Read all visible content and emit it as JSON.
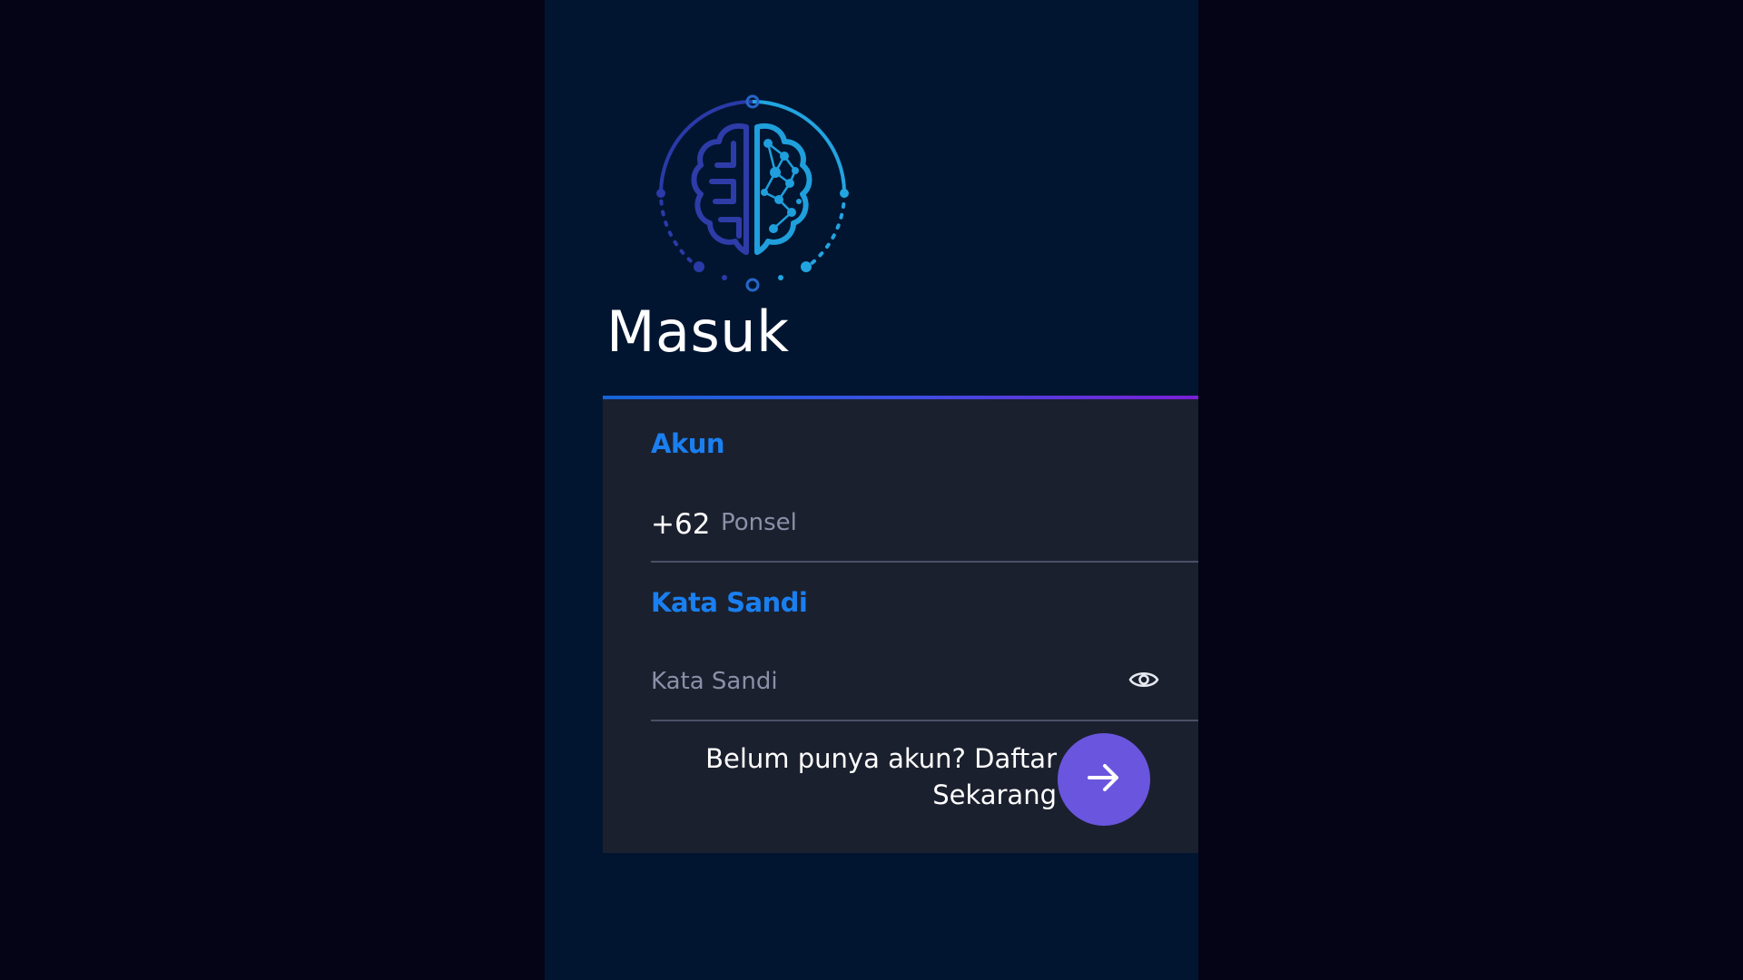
{
  "page": {
    "title": "Masuk"
  },
  "form": {
    "account_label": "Akun",
    "country_code": "+62",
    "phone_placeholder": "Ponsel",
    "phone_value": "",
    "password_label": "Kata Sandi",
    "password_placeholder": "Kata Sandi",
    "password_value": "",
    "register_text": "Belum punya akun? Daftar Sekarang"
  },
  "icons": {
    "logo": "brain-circuit-logo",
    "password_toggle": "eye-icon",
    "submit": "arrow-right-icon"
  },
  "colors": {
    "background": "#040416",
    "panel": "#011531",
    "card": "#1b202e",
    "label_accent": "#1a7ff0",
    "submit_button": "#6a55de",
    "card_border_start": "#1565d8",
    "card_border_end": "#7b1fd6"
  }
}
